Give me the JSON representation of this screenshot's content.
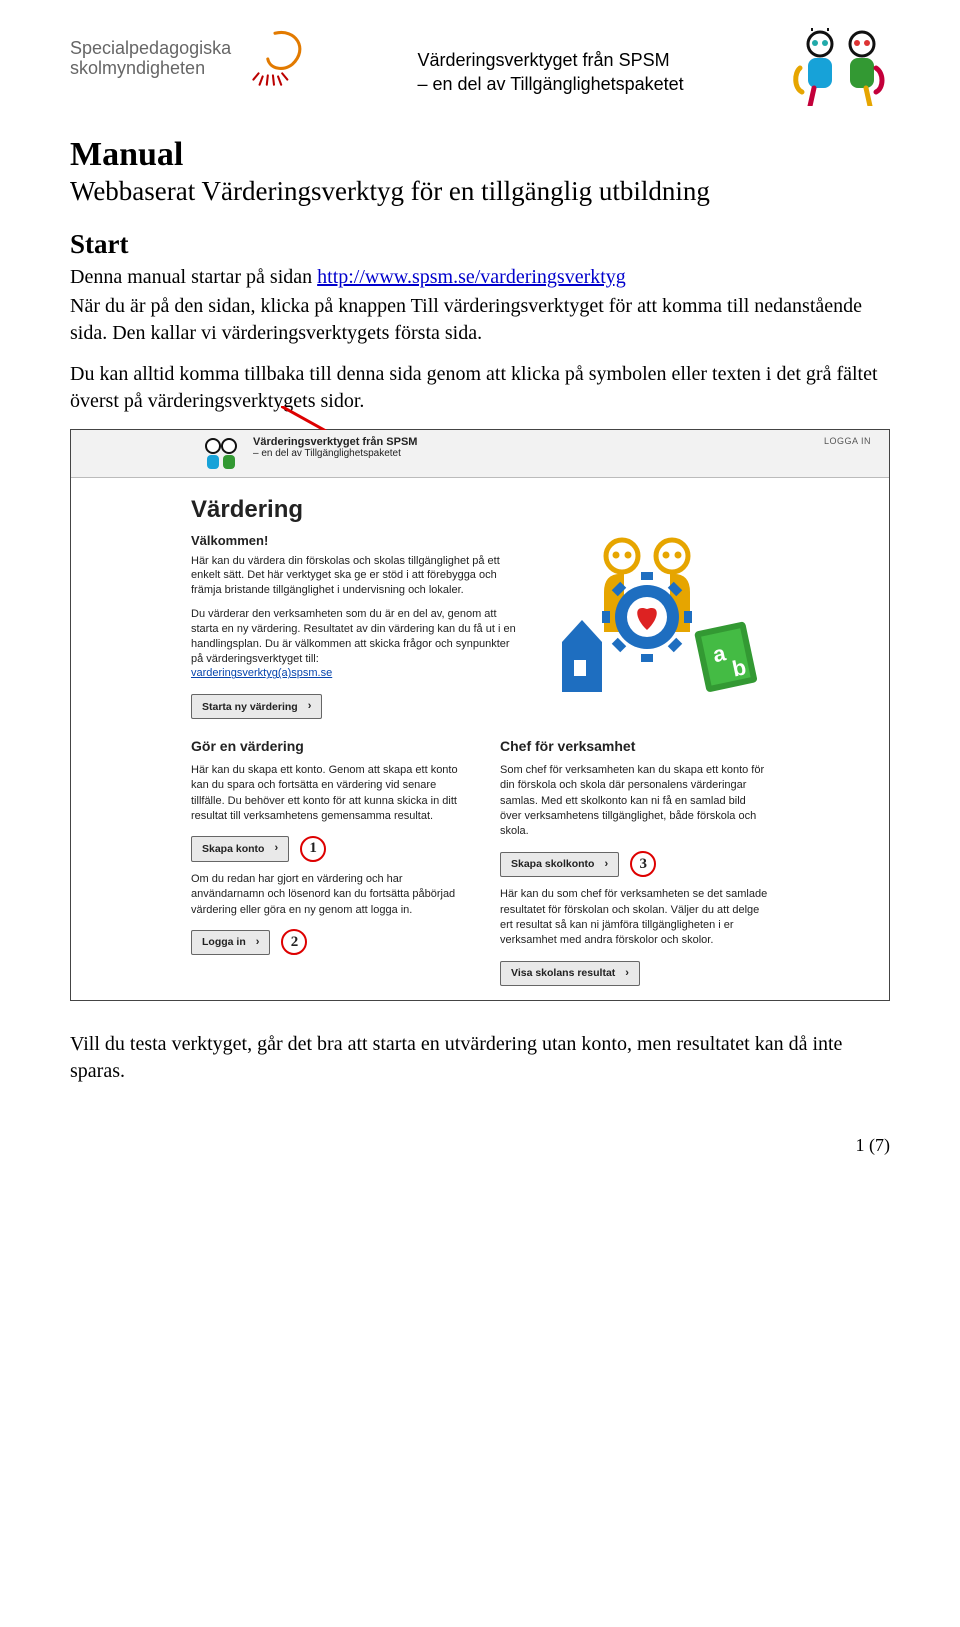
{
  "header": {
    "brand_line1": "Specialpedagogiska",
    "brand_line2": "skolmyndigheten",
    "tagline_line1": "Värderingsverktyget från SPSM",
    "tagline_line2": "– en del av Tillgänglighetspaketet"
  },
  "doc": {
    "title": "Manual",
    "subtitle": "Webbaserat Värderingsverktyg för en tillgänglig utbildning",
    "start_heading": "Start",
    "p1_pre": "Denna manual startar på sidan ",
    "p1_link": "http://www.spsm.se/varderingsverktyg",
    "p2": "När du är på den sidan, klicka på knappen Till värderingsverktyget för att komma till nedanstående sida. Den kallar vi värderingsverktygets första sida.",
    "p3": "Du kan alltid komma tillbaka till denna sida genom att klicka på symbolen eller texten i det grå fältet överst på värderingsverktygets sidor.",
    "closing": "Vill du testa verktyget, går det bra att starta en utvärdering utan konto, men resultatet kan då inte sparas.",
    "page_num": "1 (7)"
  },
  "screenshot": {
    "login_label": "LOGGA IN",
    "top_title": "Värderingsverktyget från SPSM",
    "top_sub": "– en del av Tillgänglighetspaketet",
    "vardering_heading": "Värdering",
    "welcome_heading": "Välkommen!",
    "welcome_p1": "Här kan du värdera din förskolas och skolas tillgänglighet på ett enkelt sätt. Det här verktyget ska ge er stöd i att förebygga och främja bristande tillgänglighet i undervisning och lokaler.",
    "welcome_p2": "Du värderar den verksamheten som du är en del av, genom att starta en ny värdering. Resultatet av din värdering kan du få ut i en handlingsplan. Du är välkommen att skicka frågor och synpunkter på värderingsverktyget till:",
    "welcome_email": "varderingsverktyg(a)spsm.se",
    "start_button": "Starta ny värdering",
    "col1": {
      "heading": "Gör en värdering",
      "p1": "Här kan du skapa ett konto. Genom att skapa ett konto kan du spara och fortsätta en värdering vid senare tillfälle. Du behöver ett konto för att kunna skicka in ditt resultat till verksamhetens gemensamma resultat.",
      "btn1": "Skapa konto",
      "p2": "Om du redan har gjort en värdering och har användarnamn och lösenord kan du fortsätta påbörjad värdering eller göra en ny genom att logga in.",
      "btn2": "Logga in"
    },
    "col2": {
      "heading": "Chef för verksamhet",
      "p1": "Som chef för verksamheten kan du skapa ett konto för din förskola och skola där personalens värderingar samlas. Med ett skolkonto kan ni få en samlad bild över verksamhetens tillgänglighet, både förskola och skola.",
      "btn1": "Skapa skolkonto",
      "p2": "Här kan du som chef för verksamheten se det samlade resultatet för förskolan och skolan. Väljer du att delge ert resultat så kan ni jämföra tillgängligheten i er verksamhet med andra förskolor och skolor.",
      "btn2": "Visa skolans resultat"
    },
    "labels": {
      "num1": "1",
      "num2": "2",
      "num3": "3"
    }
  }
}
